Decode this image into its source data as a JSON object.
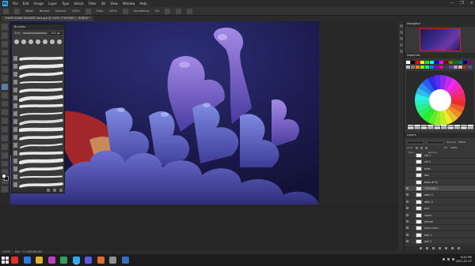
{
  "menubar": {
    "logo": "Ps",
    "items": [
      "File",
      "Edit",
      "Image",
      "Layer",
      "Type",
      "Select",
      "Filter",
      "3D",
      "View",
      "Window",
      "Help"
    ],
    "window_controls": [
      "—",
      "❐",
      "✕"
    ]
  },
  "options": {
    "opacity_label": "Opacity:",
    "opacity_value": "100%",
    "flow_label": "Flow:",
    "flow_value": "100%",
    "smoothing_label": "Smoothing:",
    "smoothing_value": "0%",
    "mode_label": "Mode:",
    "mode_value": "Normal"
  },
  "document": {
    "tab_title": "CHAIR ASIAN SEASIDE 2bd.psd @ 100% (TYHOND 2, RGB/8) *"
  },
  "brushes": {
    "title": "Brushes",
    "size_label": "Size:",
    "size_value": "125 px",
    "count": 17
  },
  "status": {
    "zoom": "100%",
    "doc": "Doc: 11.2M/188.8M"
  },
  "navigator": {
    "title": "Navigator"
  },
  "swatches": {
    "title": "Swatches",
    "colors": [
      "#ffffff",
      "#000000",
      "#ff0000",
      "#ffff00",
      "#00ff00",
      "#00ffff",
      "#0000ff",
      "#ff00ff",
      "#7f0000",
      "#7f7f00",
      "#007f00",
      "#007f7f",
      "#00007f",
      "#7f007f",
      "#c0c0c0",
      "#808080",
      "#ff7f00",
      "#7fff00",
      "#00ff7f",
      "#007fff",
      "#7f00ff",
      "#ff007f",
      "#3a3a6a",
      "#6a4a9a",
      "#b0a0e0",
      "#e0c0a0",
      "#a03030",
      "#5050a0"
    ]
  },
  "layers": {
    "title": "Layers",
    "kind_label": "Kind",
    "blend_mode": "Normal",
    "opacity_label": "Opacity:",
    "opacity_value": "100%",
    "lock_label": "Lock:",
    "fill_label": "Fill:",
    "fill_value": "100%",
    "items": [
      {
        "name": "sat 1",
        "visible": false,
        "selected": false
      },
      {
        "name": "sat 2",
        "visible": false,
        "selected": false
      },
      {
        "name": "brkd",
        "visible": false,
        "selected": false
      },
      {
        "name": "dbs",
        "visible": false,
        "selected": false
      },
      {
        "name": "body dt fx",
        "visible": false,
        "selected": false
      },
      {
        "name": "TYHOND 2",
        "visible": true,
        "selected": true
      },
      {
        "name": "after 1",
        "visible": true,
        "selected": false
      },
      {
        "name": "after 2",
        "visible": true,
        "selected": false
      },
      {
        "name": "gua",
        "visible": true,
        "selected": false
      },
      {
        "name": "vexm",
        "visible": true,
        "selected": false
      },
      {
        "name": "jmusm",
        "visible": true,
        "selected": false
      },
      {
        "name": "hunn meni",
        "visible": true,
        "selected": false
      },
      {
        "name": "bak 1",
        "visible": true,
        "selected": false
      },
      {
        "name": "bak 2",
        "visible": true,
        "selected": false
      }
    ]
  },
  "taskbar": {
    "time": "9:44 PM",
    "date": "2021-07-07",
    "apps": [
      {
        "color": "#e03030"
      },
      {
        "color": "#2d7be0"
      },
      {
        "color": "#e0b030"
      },
      {
        "color": "#c040c0"
      },
      {
        "color": "#30a060"
      },
      {
        "color": "#31a8ff",
        "active": true
      },
      {
        "color": "#5a5ae0"
      },
      {
        "color": "#e06a30"
      },
      {
        "color": "#909090"
      },
      {
        "color": "#3070c0"
      }
    ]
  }
}
